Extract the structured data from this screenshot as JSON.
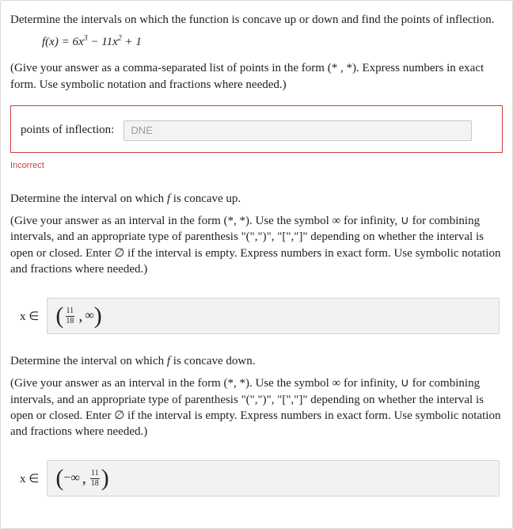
{
  "intro": {
    "instruction": "Determine the intervals on which the function is concave up or down and find the points of inflection.",
    "formula_fx": "f(x) = 6x",
    "formula_sup1": "3",
    "formula_mid": " − 11x",
    "formula_sup2": "2",
    "formula_tail": " + 1",
    "hint": "(Give your answer as a comma-separated list of points in the form (* , *). Express numbers in exact form. Use symbolic notation and fractions where needed.)"
  },
  "box1": {
    "label": "points of inflection:",
    "value": "DNE",
    "feedback": "Incorrect"
  },
  "concave_up": {
    "title_pre": "Determine the interval on which ",
    "title_f": "f",
    "title_post": " is concave up.",
    "hint": "(Give your answer as an interval in the form (*, *). Use the symbol ∞ for infinity, ∪ for combining intervals, and an appropriate type of parenthesis \"(\",\")\", \"[\",\"]\" depending on whether the interval is open or closed. Enter ∅ if the interval is empty. Express numbers in exact form. Use symbolic notation and fractions where needed.)",
    "x_in": "x ∈",
    "lparen": "(",
    "frac_num": "11",
    "frac_den": "18",
    "comma": ",",
    "infty": "∞",
    "rparen": ")"
  },
  "concave_down": {
    "title_pre": "Determine the interval on which ",
    "title_f": "f",
    "title_post": " is concave down.",
    "hint": "(Give your answer as an interval in the form (*, *). Use the symbol ∞ for infinity, ∪ for combining intervals, and an appropriate type of parenthesis \"(\",\")\", \"[\",\"]\" depending on whether the interval is open or closed. Enter ∅ if the interval is empty. Express numbers in exact form. Use symbolic notation and fractions where needed.)",
    "x_in": "x ∈",
    "lparen": "(",
    "neg_infty": "−∞",
    "comma": ",",
    "frac_num": "11",
    "frac_den": "18",
    "rparen": ")"
  }
}
